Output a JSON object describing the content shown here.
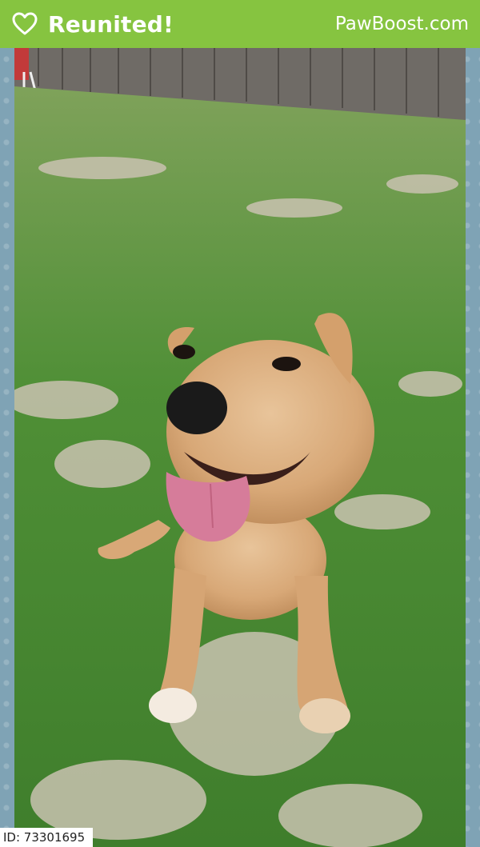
{
  "header": {
    "icon": "heart-icon",
    "title": "Reunited!",
    "brand": "PawBoost.com",
    "background": "#86c440"
  },
  "photo": {
    "subject": "dog-photo"
  },
  "id_tag": {
    "text": "ID: 73301695"
  }
}
